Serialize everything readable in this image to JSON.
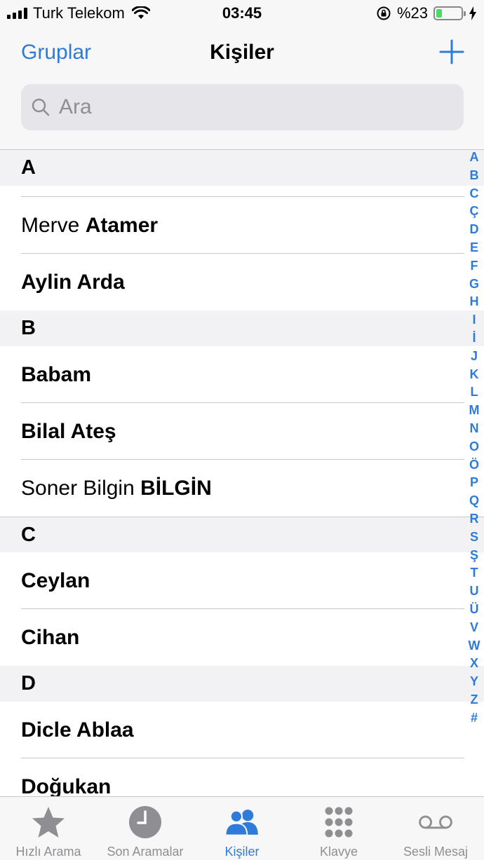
{
  "status_bar": {
    "carrier": "Turk Telekom",
    "time": "03:45",
    "battery_text": "%23",
    "battery_level": 0.23,
    "battery_color": "#4cd964"
  },
  "nav": {
    "left_label": "Gruplar",
    "title": "Kişiler",
    "add_icon": "plus-icon"
  },
  "search": {
    "placeholder": "Ara"
  },
  "accent_color": "#2f7bd9",
  "sections": [
    {
      "letter": "A",
      "contacts": [
        {
          "first": "Merve",
          "last": "Atamer"
        },
        {
          "first": "",
          "last": "Aylin Arda"
        }
      ]
    },
    {
      "letter": "B",
      "contacts": [
        {
          "first": "",
          "last": "Babam"
        },
        {
          "first": "",
          "last": "Bilal Ateş"
        },
        {
          "first": "Soner Bilgin",
          "last": "BİLGİN"
        }
      ]
    },
    {
      "letter": "C",
      "contacts": [
        {
          "first": "",
          "last": "Ceylan"
        },
        {
          "first": "",
          "last": "Cihan"
        }
      ]
    },
    {
      "letter": "D",
      "contacts": [
        {
          "first": "",
          "last": "Dicle Ablaa"
        },
        {
          "first": "",
          "last": "Doğukan"
        }
      ]
    }
  ],
  "index": [
    "A",
    "B",
    "C",
    "Ç",
    "D",
    "E",
    "F",
    "G",
    "H",
    "I",
    "İ",
    "J",
    "K",
    "L",
    "M",
    "N",
    "O",
    "Ö",
    "P",
    "Q",
    "R",
    "S",
    "Ş",
    "T",
    "U",
    "Ü",
    "V",
    "W",
    "X",
    "Y",
    "Z",
    "#"
  ],
  "tabs": [
    {
      "label": "Hızlı Arama",
      "icon": "star-icon",
      "active": false
    },
    {
      "label": "Son Aramalar",
      "icon": "clock-icon",
      "active": false
    },
    {
      "label": "Kişiler",
      "icon": "contacts-icon",
      "active": true
    },
    {
      "label": "Klavye",
      "icon": "keypad-icon",
      "active": false
    },
    {
      "label": "Sesli Mesaj",
      "icon": "voicemail-icon",
      "active": false
    }
  ]
}
